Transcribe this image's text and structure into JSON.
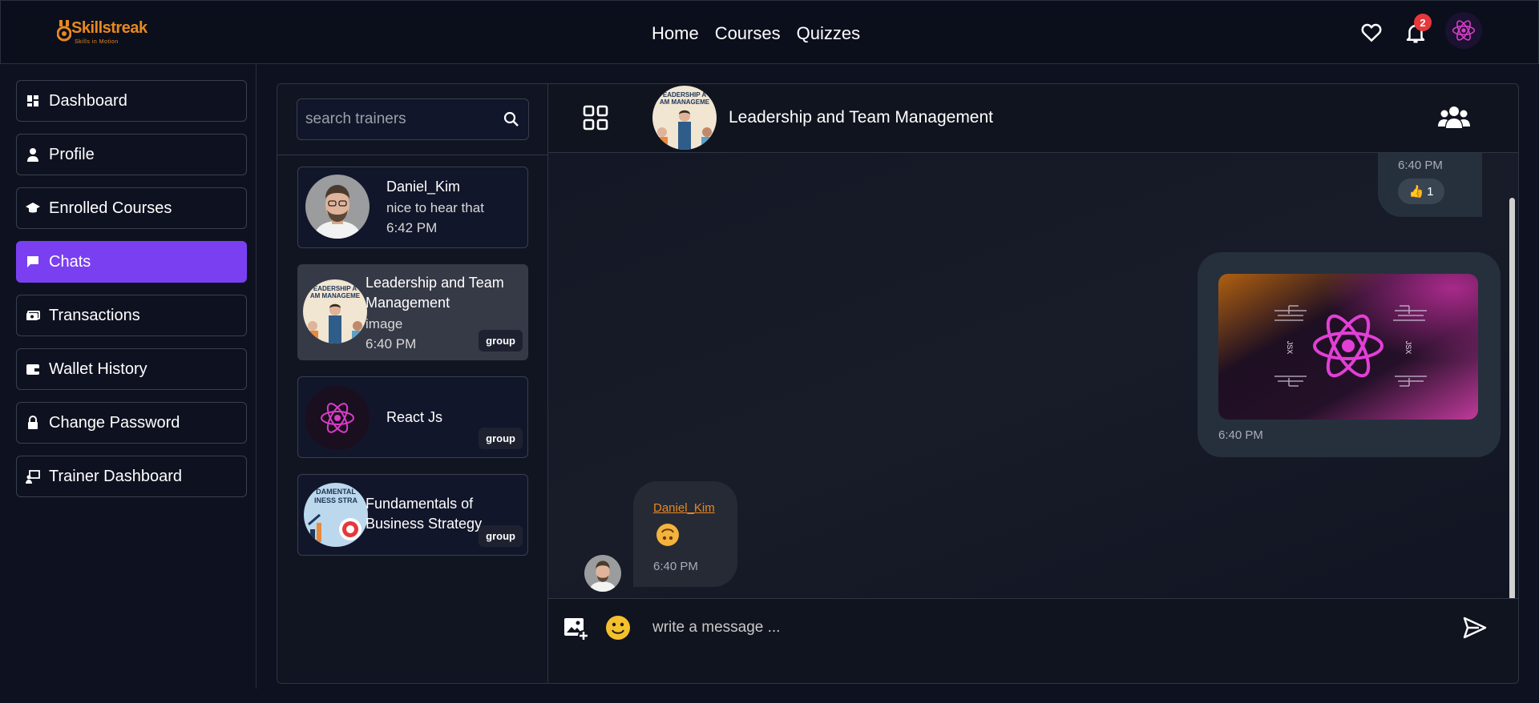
{
  "brand": {
    "name": "Skillstreak",
    "tagline": "Skills in Motion",
    "color": "#e8891f"
  },
  "nav": {
    "links": [
      "Home",
      "Courses",
      "Quizzes"
    ],
    "notification_count": "2"
  },
  "sidebar": {
    "items": [
      {
        "label": "Dashboard",
        "icon": "dashboard-icon"
      },
      {
        "label": "Profile",
        "icon": "user-icon"
      },
      {
        "label": "Enrolled Courses",
        "icon": "graduation-cap-icon"
      },
      {
        "label": "Chats",
        "icon": "chat-icon",
        "active": true
      },
      {
        "label": "Transactions",
        "icon": "money-icon"
      },
      {
        "label": "Wallet History",
        "icon": "wallet-icon"
      },
      {
        "label": "Change Password",
        "icon": "lock-icon"
      },
      {
        "label": "Trainer Dashboard",
        "icon": "trainer-icon"
      }
    ],
    "accent": "#7b3ff2"
  },
  "chat_list": {
    "search_placeholder": "search trainers",
    "conversations": [
      {
        "name": "Daniel_Kim",
        "last_message": "nice to hear that",
        "time": "6:42 PM"
      },
      {
        "name": "Leadership and Team Management",
        "last_message": "image",
        "time": "6:40 PM",
        "tag": "group",
        "selected": true
      },
      {
        "name": "React Js",
        "tag": "group"
      },
      {
        "name": "Fundamentals of Business Strategy",
        "tag": "group"
      }
    ]
  },
  "conversation": {
    "title": "Leadership and Team Management",
    "messages": [
      {
        "time": "6:40 PM",
        "reaction_emoji": "👍",
        "reaction_count": "1"
      },
      {
        "type": "image",
        "time": "6:40 PM",
        "image_labels": [
          "JSX",
          "JSX"
        ]
      },
      {
        "sender": "Daniel_Kim",
        "emoji": "upside-down-face",
        "time": "6:40 PM"
      }
    ],
    "composer_placeholder": "write a message ..."
  }
}
